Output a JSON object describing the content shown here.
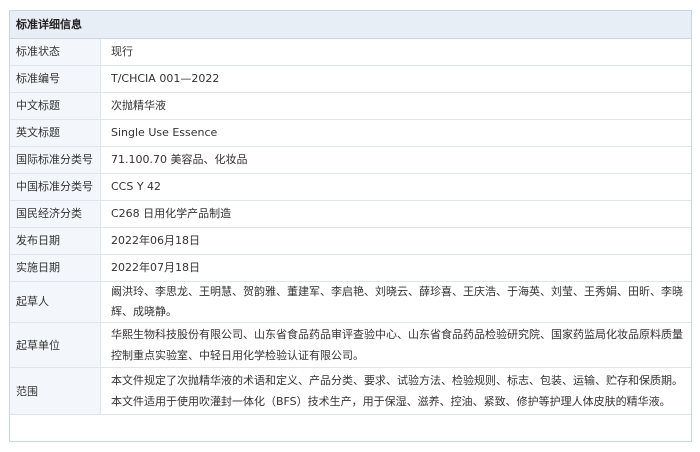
{
  "panel": {
    "title": "标准详细信息"
  },
  "rows": [
    {
      "label": "标准状态",
      "value": "现行"
    },
    {
      "label": "标准编号",
      "value": "T/CHCIA 001—2022"
    },
    {
      "label": "中文标题",
      "value": "次抛精华液"
    },
    {
      "label": "英文标题",
      "value": "Single Use Essence"
    },
    {
      "label": "国际标准分类号",
      "value": "71.100.70 美容品、化妆品"
    },
    {
      "label": "中国标准分类号",
      "value": "CCS Y 42"
    },
    {
      "label": "国民经济分类",
      "value": "C268 日用化学产品制造"
    },
    {
      "label": "发布日期",
      "value": "2022年06月18日"
    },
    {
      "label": "实施日期",
      "value": "2022年07月18日"
    },
    {
      "label": "起草人",
      "value": "阚洪玲、李思龙、王明慧、贺韵雅、董建军、李启艳、刘晓云、薛珍喜、王庆浩、于海英、刘莹、王秀娟、田昕、李晓辉、成晓静。"
    },
    {
      "label": "起草单位",
      "value": "华熙生物科技股份有限公司、山东省食品药品审评查验中心、山东省食品药品检验研究院、国家药监局化妆品原料质量控制重点实验室、中轻日用化学检验认证有限公司。"
    },
    {
      "label": "范围",
      "value": "本文件规定了次抛精华液的术语和定义、产品分类、要求、试验方法、检验规则、标志、包装、运输、贮存和保质期。 本文件适用于使用吹灌封一体化（BFS）技术生产，用于保湿、滋养、控油、紧致、修护等护理人体皮肤的精华液。"
    }
  ]
}
